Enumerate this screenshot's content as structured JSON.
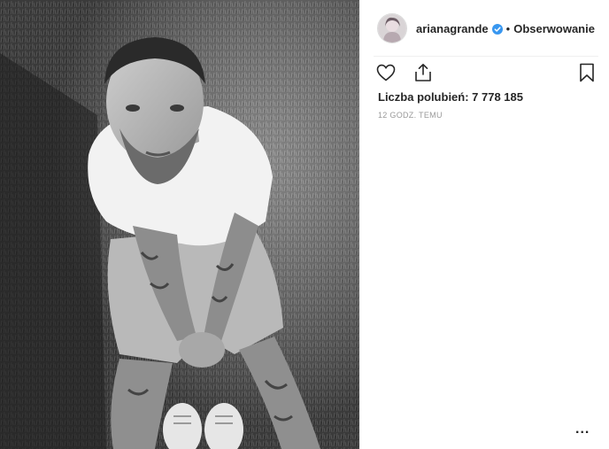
{
  "post": {
    "username": "arianagrande",
    "verified": true,
    "separator": "•",
    "follow_label": "Obserwowanie",
    "likes_text": "Liczba polubień: 7 778 185",
    "timestamp": "12 GODZ. TEMU",
    "more_label": "..."
  },
  "icons": {
    "like": "heart-icon",
    "share": "share-icon",
    "save": "bookmark-icon",
    "verified": "verified-badge-icon"
  },
  "colors": {
    "verified_blue": "#3897f0",
    "text": "#262626",
    "muted": "#999999",
    "divider": "#efefef"
  }
}
